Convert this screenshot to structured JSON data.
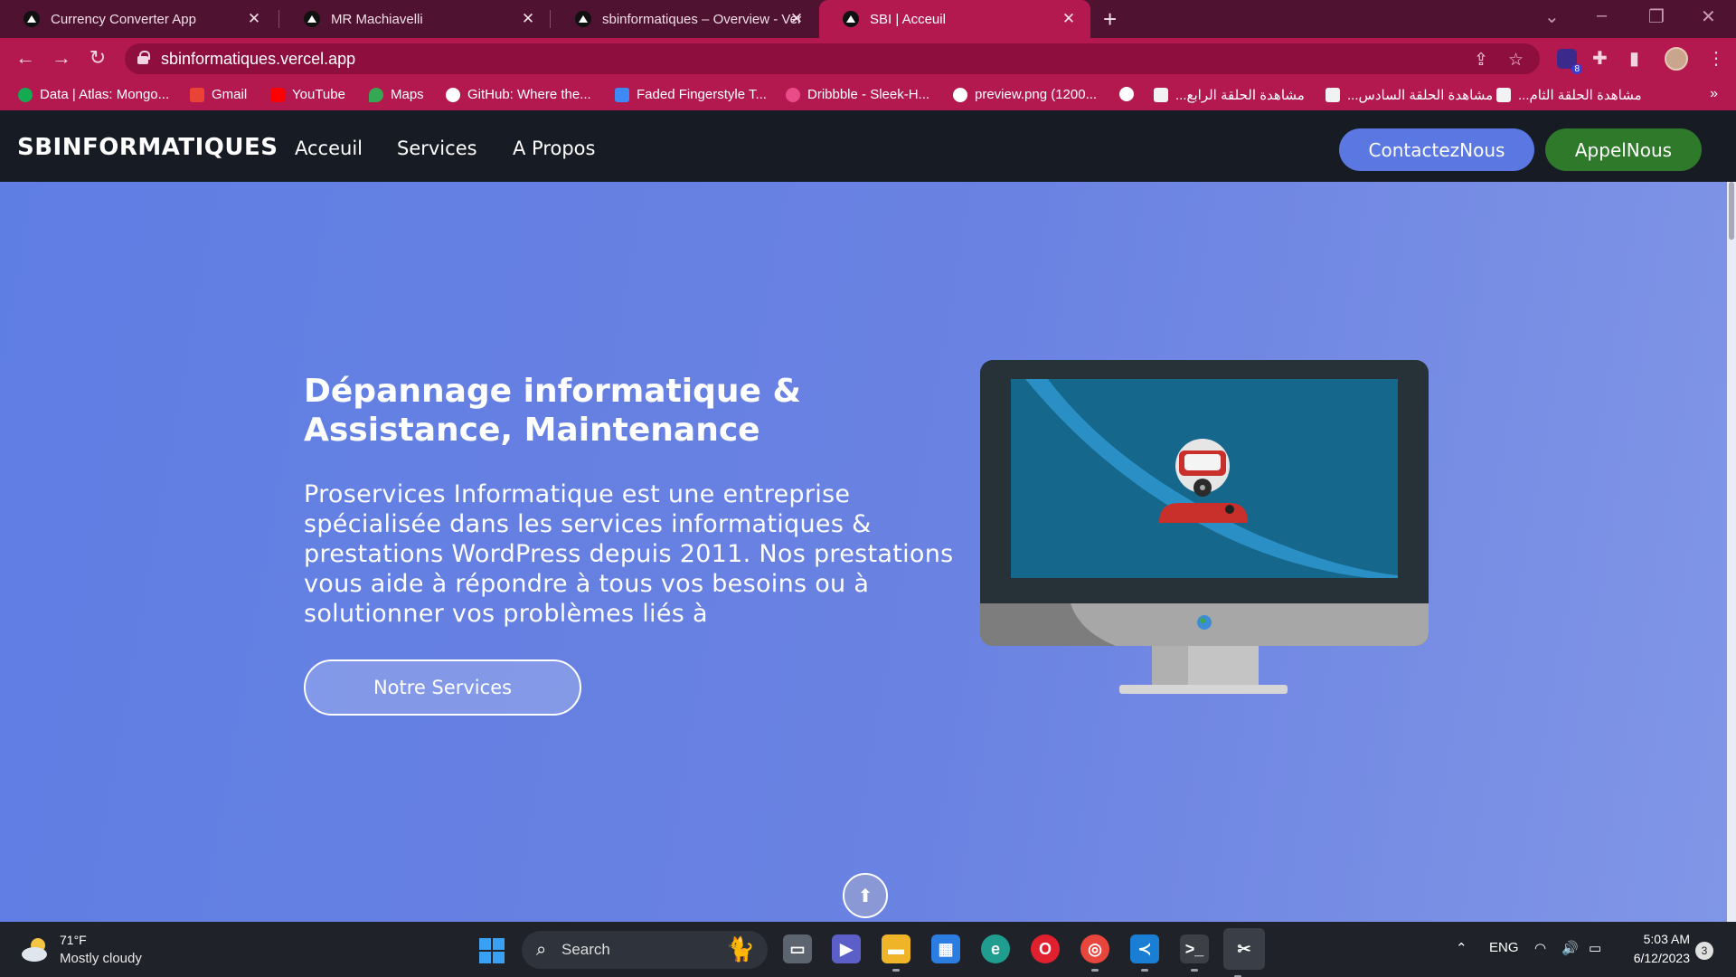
{
  "browser": {
    "tabs": [
      {
        "title": "Currency Converter App",
        "active": false
      },
      {
        "title": "MR Machiavelli",
        "active": false
      },
      {
        "title": "sbinformatiques – Overview - Ver",
        "active": false
      },
      {
        "title": "SBI | Acceuil",
        "active": true
      }
    ],
    "url": "sbinformatiques.vercel.app",
    "extension_badge": "8",
    "bookmarks": [
      {
        "label": "Data | Atlas: Mongo...",
        "icon": "mongodb-leaf-icon",
        "color": "#13aa52"
      },
      {
        "label": "Gmail",
        "icon": "gmail-icon",
        "color": "#ea4335"
      },
      {
        "label": "YouTube",
        "icon": "youtube-icon",
        "color": "#ff0000"
      },
      {
        "label": "Maps",
        "icon": "maps-pin-icon",
        "color": "#34a853"
      },
      {
        "label": "GitHub: Where the...",
        "icon": "github-icon",
        "color": "#ffffff"
      },
      {
        "label": "Faded Fingerstyle T...",
        "icon": "tabs-doc-icon",
        "color": "#3d8af7"
      },
      {
        "label": "Dribbble - Sleek-H...",
        "icon": "dribbble-icon",
        "color": "#ea4c89"
      },
      {
        "label": "preview.png (1200...",
        "icon": "globe-icon",
        "color": "#ffffff"
      },
      {
        "label": "",
        "icon": "globe-icon",
        "color": "#ffffff"
      },
      {
        "label": "مشاهدة الحلقة الرابع...",
        "icon": "site-favicon-icon",
        "color": "#f2f2f2"
      },
      {
        "label": "مشاهدة الحلقة السادس...",
        "icon": "site-favicon-icon",
        "color": "#f2f2f2"
      },
      {
        "label": "مشاهدة الحلقة الثام...",
        "icon": "site-favicon-icon",
        "color": "#f2f2f2"
      }
    ],
    "bookmarks_more": "»"
  },
  "site": {
    "brand": "SBINFORMATIQUES",
    "nav": [
      "Acceuil",
      "Services",
      "A Propos"
    ],
    "contact_button": "ContactezNous",
    "call_button": "AppelNous",
    "hero": {
      "title": "Dépannage informatique & Assistance, Maintenance",
      "text": "Proservices Informatique est une entreprise spécialisée dans les services informatiques & prestations WordPress depuis 2011. Nos prestations vous aide à répondre à tous vos besoins ou à solutionner vos problèmes liés à",
      "cta": "Notre Services"
    },
    "colors": {
      "header_bg": "#161b24",
      "hero_bg": "#6a82e2",
      "contact_button": "#5b77e2",
      "call_button": "#2f7a2a"
    }
  },
  "taskbar": {
    "weather_temp": "71°F",
    "weather_desc": "Mostly cloudy",
    "search_label": "Search",
    "language": "ENG",
    "time": "5:03 AM",
    "date": "6/12/2023",
    "notifications": "3",
    "apps": [
      "task-view-icon",
      "teams-icon",
      "file-explorer-icon",
      "store-icon",
      "edge-icon",
      "opera-icon",
      "chrome-icon",
      "vscode-icon",
      "terminal-icon",
      "snipping-tool-icon"
    ]
  }
}
